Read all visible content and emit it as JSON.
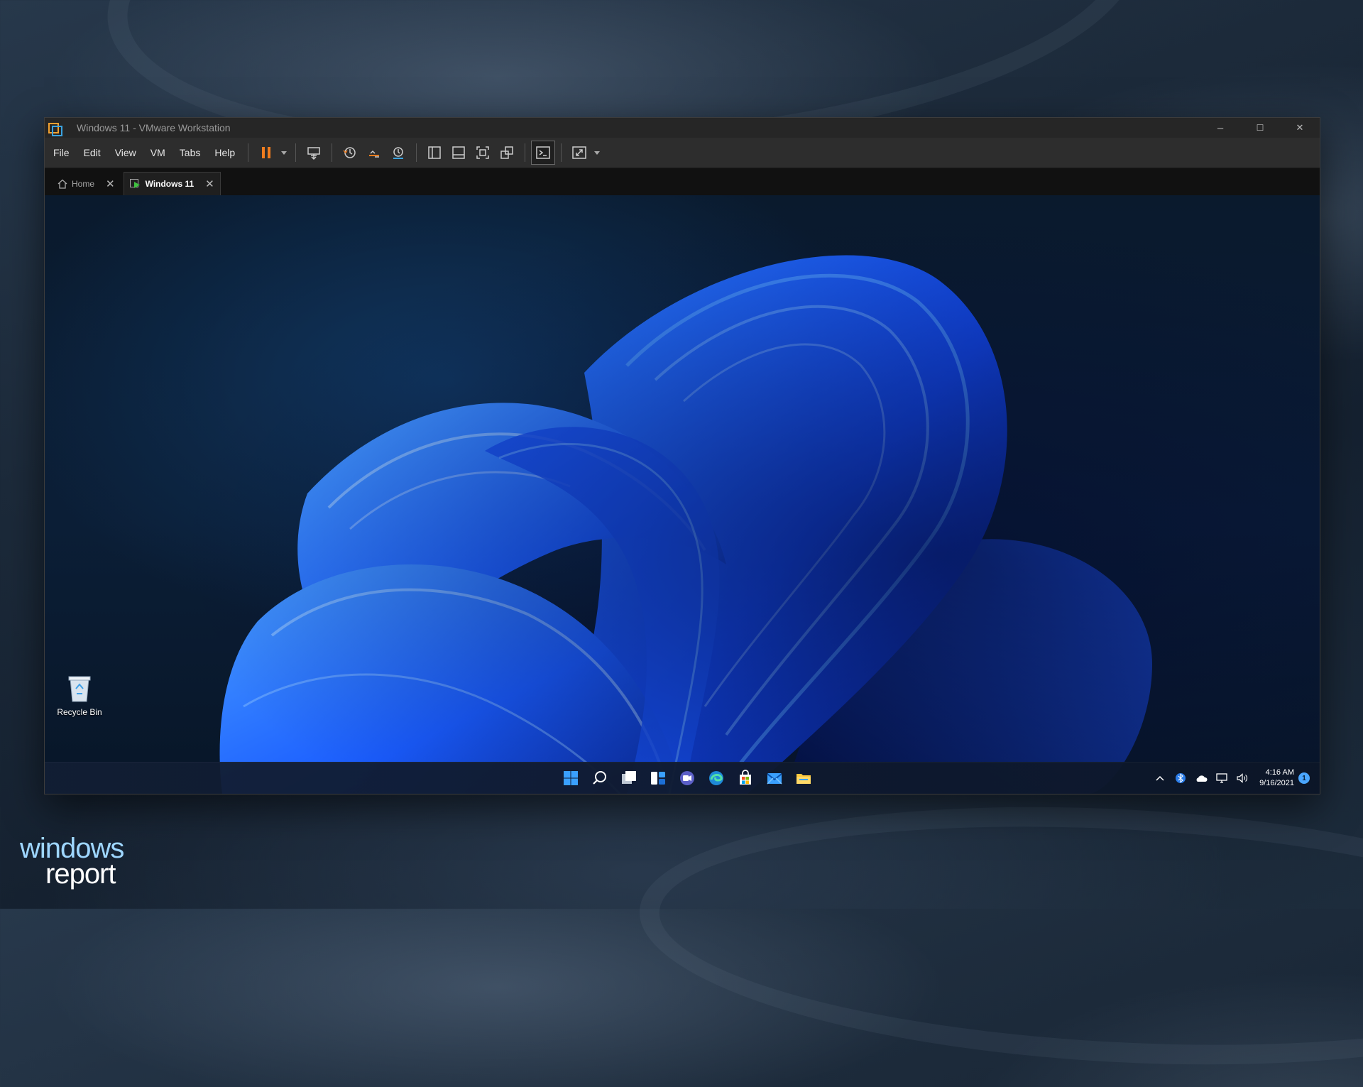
{
  "window": {
    "title": "Windows 11 - VMware Workstation",
    "controls": {
      "minimize": "–",
      "maximize": "☐",
      "close": "✕"
    }
  },
  "menu": [
    "File",
    "Edit",
    "View",
    "VM",
    "Tabs",
    "Help"
  ],
  "toolbar_icons": [
    "pause-icon",
    "dropdown-icon",
    "send-ctrl-alt-del-icon",
    "snapshot-icon",
    "revert-snapshot-icon",
    "snapshot-manager-icon",
    "show-library-icon",
    "thumbnail-bar-icon",
    "full-screen-icon",
    "unity-icon",
    "console-view-icon",
    "stretch-guest-icon"
  ],
  "tabs": [
    {
      "label": "Home",
      "active": false
    },
    {
      "label": "Windows 11",
      "active": true
    }
  ],
  "desktop": {
    "icons": [
      {
        "label": "Recycle Bin"
      }
    ]
  },
  "taskbar": {
    "apps": [
      "start-icon",
      "search-icon",
      "task-view-icon",
      "widgets-icon",
      "chat-icon",
      "edge-icon",
      "store-icon",
      "mail-icon",
      "file-explorer-icon"
    ],
    "tray": [
      "chevron-up-icon",
      "bluetooth-icon",
      "onedrive-icon",
      "network-icon",
      "volume-icon"
    ],
    "time": "4:16 AM",
    "date": "9/16/2021",
    "notification_count": "1"
  },
  "watermark": {
    "line1": "windows",
    "line2": "report"
  },
  "colors": {
    "accent_orange": "#f07c1e",
    "win11_blue": "#1a5cff",
    "desktop_bg": "#0a1a2d"
  }
}
